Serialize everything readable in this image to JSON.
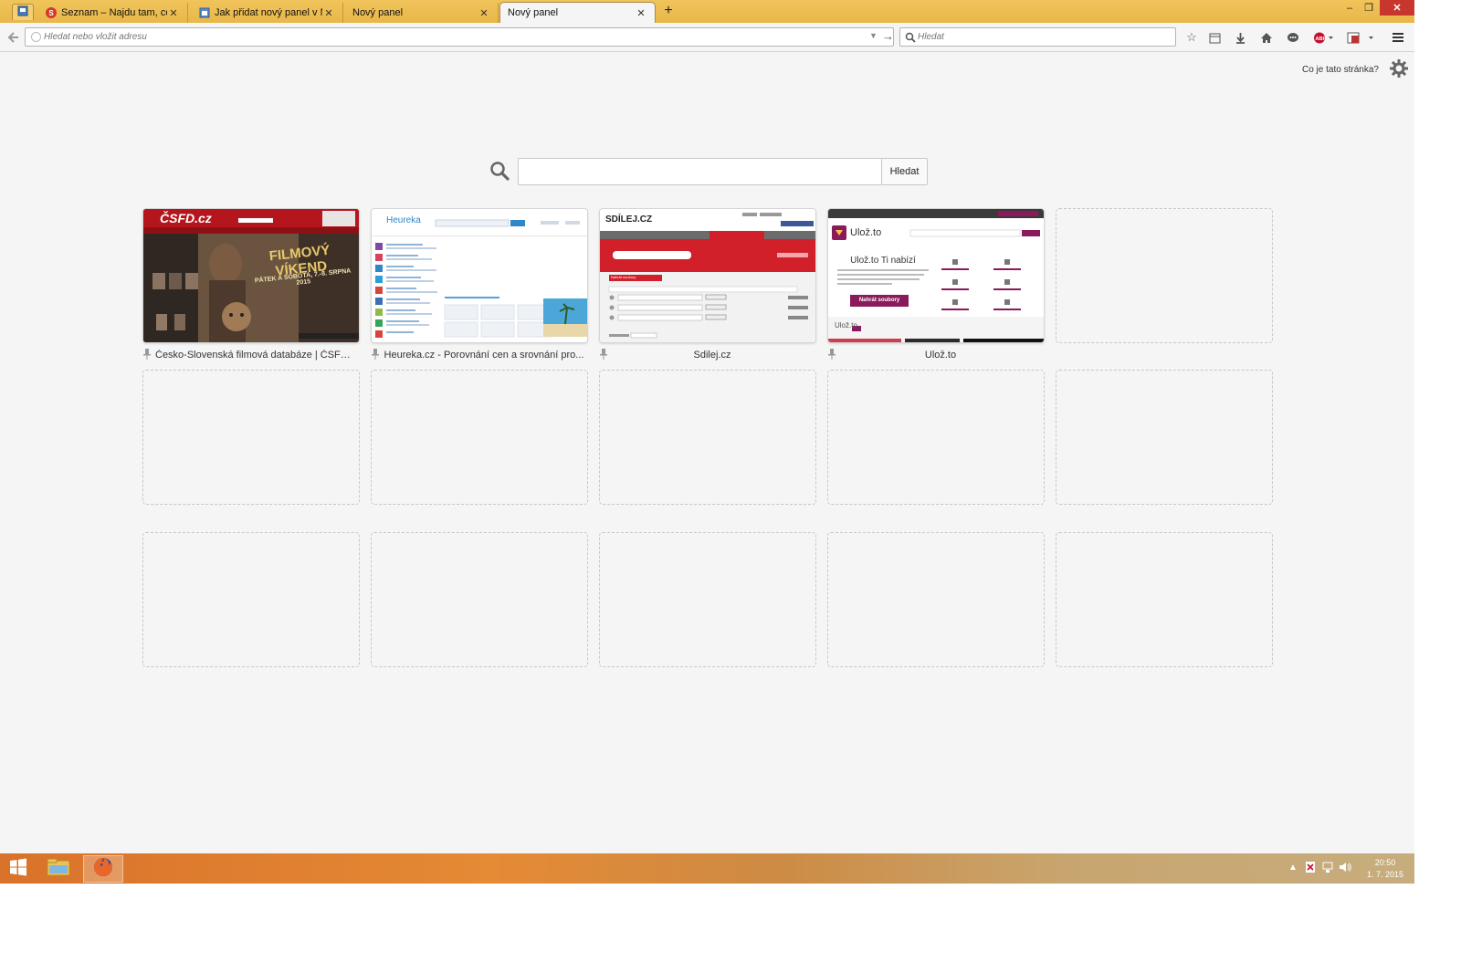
{
  "browser": {
    "tabs": [
      {
        "label": "Seznam – Najdu tam, co n...",
        "icon": "seznam-s-icon"
      },
      {
        "label": "Jak přidat nový panel v Mo...",
        "icon": "page-icon"
      },
      {
        "label": "Nový panel",
        "icon": ""
      },
      {
        "label": "Nový panel",
        "icon": "",
        "active": true
      }
    ],
    "new_tab": "+",
    "window_controls": {
      "minimize": "–",
      "restore": "❐",
      "close": "✕"
    },
    "url_placeholder": "Hledat nebo vložit adresu",
    "search_placeholder": "Hledat"
  },
  "page": {
    "what_is_this": "Co je tato stránka?",
    "search_button": "Hledat",
    "tiles": [
      {
        "title": "Česko-Slovenská filmová databáze | ČSFD.cz",
        "pinned": true,
        "thumb": "csfd"
      },
      {
        "title": "Heureka.cz - Porovnání cen a srovnání pro...",
        "pinned": true,
        "thumb": "heureka"
      },
      {
        "title": "Sdilej.cz",
        "pinned": true,
        "thumb": "sdilej"
      },
      {
        "title": "Ulož.to",
        "pinned": true,
        "thumb": "ulozto"
      }
    ],
    "thumbnails": {
      "csfd": {
        "logo": "ČSFD.cz",
        "headline": "FILMOVÝ VÍKEND",
        "subline": "PÁTEK A SOBOTA, 7.-8. SRPNA 2015"
      },
      "heureka": {
        "logo": "Heureka",
        "button": "Hledat"
      },
      "sdilej": {
        "logo": "SDÍLEJ.CZ",
        "tab": "Nahrát soubory"
      },
      "ulozto": {
        "logo": "Ulož.to",
        "heading": "Ulož.to Ti nabízí",
        "button": "Nahrát soubory",
        "footer": "Ulož.to"
      }
    }
  },
  "taskbar": {
    "time": "20:50",
    "date": "1. 7. 2015",
    "apps": [
      "start-icon",
      "file-explorer-icon",
      "firefox-icon"
    ]
  },
  "colors": {
    "tabbar": "#e8b74a",
    "taskbar_start": "#d9722a",
    "csfd_red": "#b5161d",
    "sdilej_red": "#d1202a",
    "ulozto_purple": "#8b1a5c"
  }
}
